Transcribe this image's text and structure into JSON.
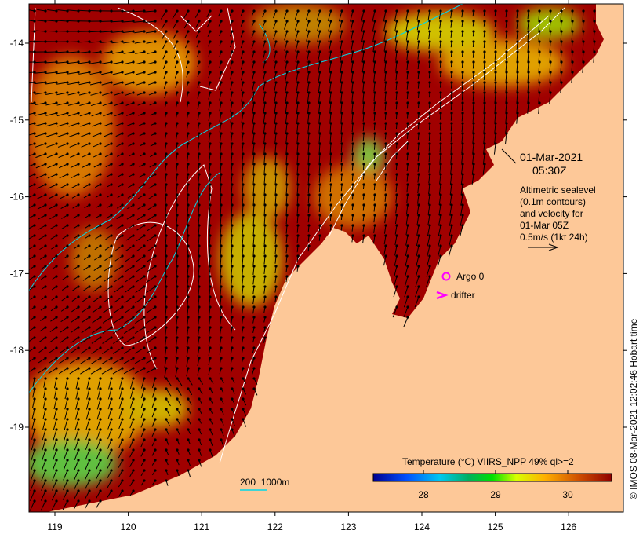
{
  "map": {
    "date": "01-Mar-2021",
    "time": "05:30Z",
    "description_lines": [
      "Altimetric sealevel",
      "(0.1m contours)",
      "and velocity for",
      "01-Mar 05Z",
      "0.5m/s (1kt 24h)"
    ],
    "legend_argo": "Argo 0",
    "legend_drifter": "drifter",
    "isobath_label": "200  1000m",
    "credit": "© IMOS 08-Mar-2021 12:02:46 Hobart time",
    "x_ticks": [
      "119",
      "120",
      "121",
      "122",
      "123",
      "124",
      "125",
      "126"
    ],
    "y_ticks": [
      "-14",
      "-15",
      "-16",
      "-17",
      "-18",
      "-19"
    ],
    "colors": {
      "land": "#fdc898",
      "ocean_warm": "#a00000",
      "argo": "#ff00ff",
      "isobath": "#00d8e8",
      "contour": "#ffffff"
    }
  },
  "colorbar": {
    "title": "Temperature (°C) VIIRS_NPP 49% ql>=2",
    "ticks": [
      "28",
      "29",
      "30"
    ],
    "range": [
      27.35,
      30.6
    ],
    "colormap": [
      "#00008f",
      "#0060ff",
      "#00d8ff",
      "#00c060",
      "#00e000",
      "#e0ff00",
      "#ffa000",
      "#c04000",
      "#8f0000"
    ]
  }
}
